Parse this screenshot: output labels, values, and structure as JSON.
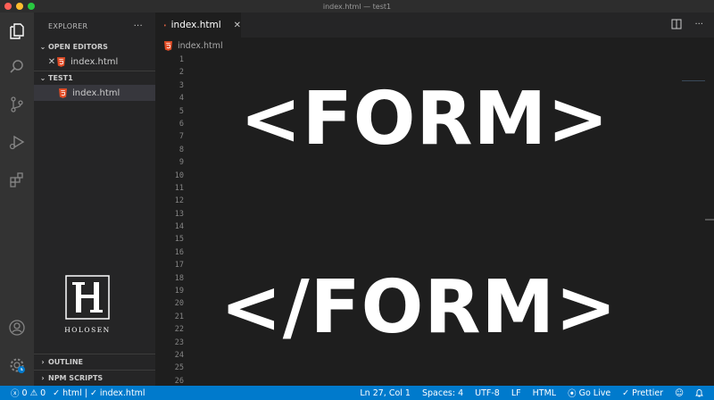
{
  "window": {
    "title": "index.html — test1"
  },
  "sidebar": {
    "title": "EXPLORER",
    "more": "···",
    "open_editors": {
      "label": "OPEN EDITORS",
      "files": [
        {
          "name": "index.html",
          "close": "✕"
        }
      ]
    },
    "workspace": {
      "label": "TEST1",
      "files": [
        {
          "name": "index.html"
        }
      ]
    },
    "outline_label": "OUTLINE",
    "npm_label": "NPM SCRIPTS"
  },
  "logo": {
    "text": "HOLOSEN"
  },
  "editor": {
    "tab": {
      "label": "index.html",
      "close": "✕"
    },
    "breadcrumb": "index.html",
    "line_numbers": [
      "1",
      "2",
      "3",
      "4",
      "5",
      "6",
      "7",
      "8",
      "9",
      "10",
      "11",
      "12",
      "13",
      "14",
      "15",
      "16",
      "17",
      "18",
      "19",
      "20",
      "21",
      "22",
      "23",
      "24",
      "25",
      "26"
    ],
    "code_open": "<FORM>",
    "code_close": "</FORM>"
  },
  "statusbar": {
    "errors": "0",
    "warnings": "0",
    "check_html": "html",
    "separator": "|",
    "check_file": "index.html",
    "position": "Ln 27, Col 1",
    "spaces": "Spaces: 4",
    "encoding": "UTF-8",
    "eol": "LF",
    "language": "HTML",
    "golive": "Go Live",
    "prettier": "Prettier"
  },
  "colors": {
    "accent": "#007acc",
    "html_icon": "#e44d26"
  }
}
